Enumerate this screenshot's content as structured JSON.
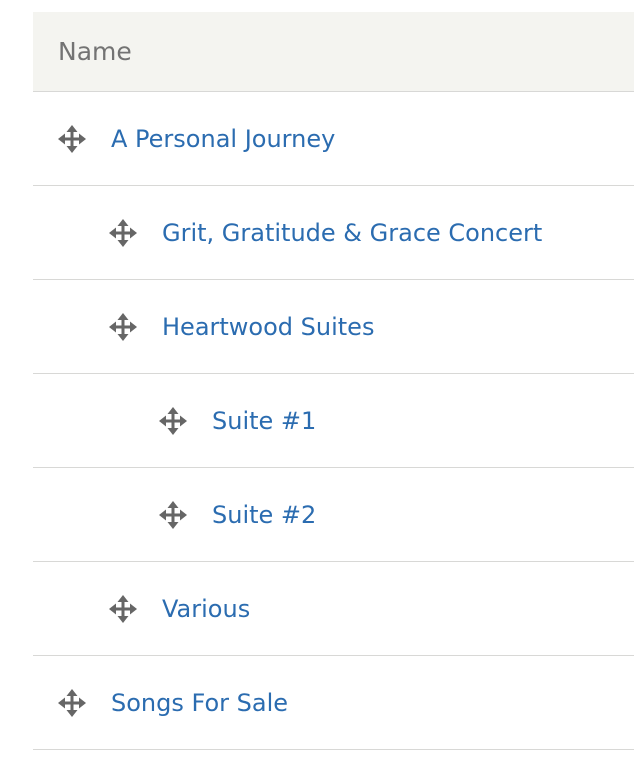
{
  "table": {
    "header": "Name",
    "rows": [
      {
        "label": "A Personal Journey",
        "depth": 0,
        "icon": "drag-move-icon"
      },
      {
        "label": "Grit, Gratitude & Grace Concert",
        "depth": 1,
        "icon": "drag-move-icon"
      },
      {
        "label": "Heartwood Suites",
        "depth": 1,
        "icon": "drag-move-icon"
      },
      {
        "label": "Suite #1",
        "depth": 2,
        "icon": "drag-move-icon"
      },
      {
        "label": "Suite #2",
        "depth": 2,
        "icon": "drag-move-icon"
      },
      {
        "label": "Various",
        "depth": 1,
        "icon": "drag-move-icon"
      },
      {
        "label": "Songs For Sale",
        "depth": 0,
        "icon": "drag-move-icon"
      }
    ]
  },
  "colors": {
    "link": "#2b6cb0",
    "header_bg": "#f4f4f0",
    "header_text": "#737373",
    "border": "#d8d8d6",
    "icon": "#666666"
  }
}
